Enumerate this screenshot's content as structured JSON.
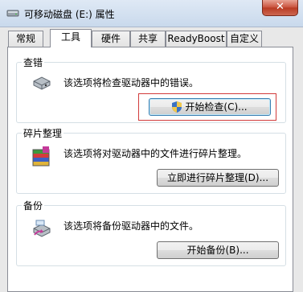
{
  "window": {
    "title": "可移动磁盘 (E:) 属性",
    "close_label": "✕"
  },
  "tabs": [
    {
      "label": "常规"
    },
    {
      "label": "工具",
      "active": true
    },
    {
      "label": "硬件"
    },
    {
      "label": "共享"
    },
    {
      "label": "ReadyBoost"
    },
    {
      "label": "自定义"
    }
  ],
  "check": {
    "title": "查错",
    "description": "该选项将检查驱动器中的错误。",
    "button": "开始检查(C)..."
  },
  "defrag": {
    "title": "碎片整理",
    "description": "该选项将对驱动器中的文件进行碎片整理。",
    "button": "立即进行碎片整理(D)..."
  },
  "backup": {
    "title": "备份",
    "description": "该选项将备份驱动器中的文件。",
    "button": "开始备份(B)..."
  },
  "icons": {
    "title": "drive-icon",
    "check": "disk-check-icon",
    "defrag": "defrag-icon",
    "backup": "backup-icon",
    "shield": "uac-shield-icon"
  }
}
